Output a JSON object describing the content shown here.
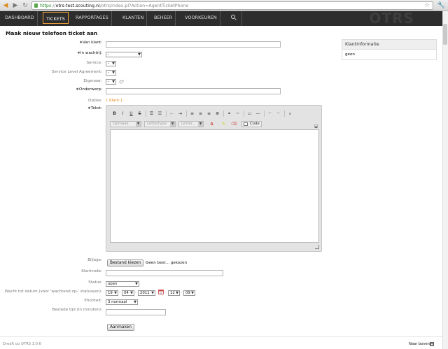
{
  "browser": {
    "url_https": "https",
    "url_host": "otrs-test.scouting.nl",
    "url_path": "/otrs/index.pl?Action=AgentTicketPhone"
  },
  "nav": {
    "items": [
      {
        "label": "DASHBOARD"
      },
      {
        "label": "TICKETS"
      },
      {
        "label": "RAPPORTAGES"
      },
      {
        "label": "KLANTEN"
      },
      {
        "label": "BEHEER"
      },
      {
        "label": "VOORKEUREN"
      }
    ],
    "background_logo": "OTRS"
  },
  "page": {
    "title": "Maak nieuw telefoon ticket aan"
  },
  "form": {
    "van_klant_label": "Van klant:",
    "in_wachtrij_label": "In wachtrij:",
    "in_wachtrij_value": "-",
    "service_label": "Service:",
    "service_value": "-",
    "sla_label": "Service Level Agreement:",
    "sla_value": "-",
    "eigenaar_label": "Eigenaar:",
    "eigenaar_value": "-",
    "onderwerp_label": "Onderwerp:",
    "opties_label": "Opties:",
    "opties_link": "[ Klant ]",
    "tekst_label": "Tekst:",
    "bijlage_label": "Bijlage:",
    "bijlage_button": "Bestand kiezen",
    "bijlage_status": "Geen best... gekozen",
    "klantcode_label": "Klantcode:",
    "status_label": "Status:",
    "status_value": "open",
    "wacht_label": "Wacht tot datum (voor 'wachtend op-' statussen):",
    "wacht_day": "19",
    "wacht_month": "04",
    "wacht_year": "2011",
    "wacht_hour": "12",
    "wacht_minute": "09",
    "sep_dash": "-",
    "sep_colon": ":",
    "prioriteit_label": "Prioriteit:",
    "prioriteit_value": "3 normaal",
    "bestede_tijd_label": "Bestede tijd (in minuten):",
    "submit_button": "Aanmaken"
  },
  "editor": {
    "opmaak": "Opmaak",
    "lettertype": "Lettertype",
    "lettergrootte": "Letter...",
    "code_button": "Code"
  },
  "sidebar": {
    "title": "Klantinformatie",
    "value": "geen"
  },
  "footer": {
    "powered": "Dreaft op OTRS 3.0.6",
    "top_link": "Naar boven"
  },
  "colors": {
    "accent": "#f3a33a",
    "nav_bg": "#2d2d2d",
    "link": "#e08b1c"
  }
}
